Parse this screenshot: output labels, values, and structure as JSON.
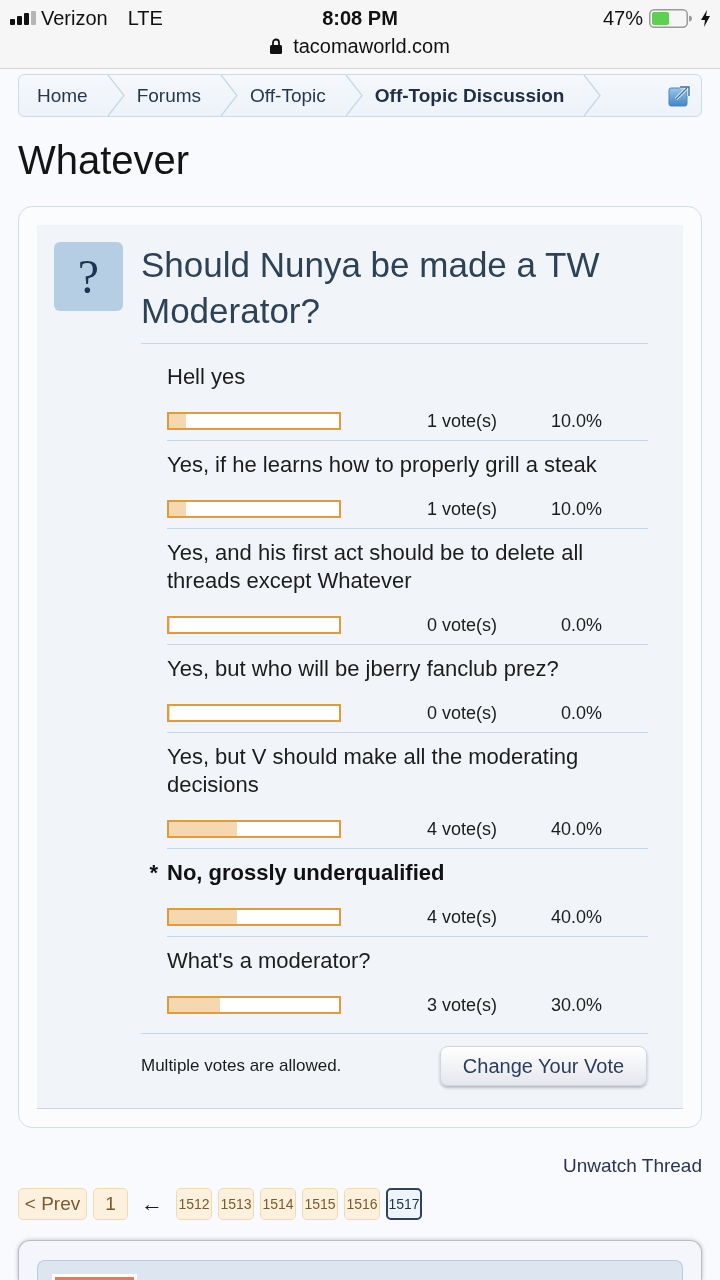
{
  "status_bar": {
    "carrier": "Verizon",
    "network": "LTE",
    "time": "8:08 PM",
    "battery": "47%",
    "charging": true
  },
  "address_bar": {
    "url": "tacomaworld.com",
    "secure": true
  },
  "breadcrumb": [
    {
      "label": "Home",
      "selected": false
    },
    {
      "label": "Forums",
      "selected": false
    },
    {
      "label": "Off-Topic",
      "selected": false
    },
    {
      "label": "Off-Topic Discussion",
      "selected": true
    }
  ],
  "thread_title": "Whatever",
  "poll": {
    "icon": "?",
    "question": "Should Nunya be made a TW Moderator?",
    "voted_marker": "*",
    "options": [
      {
        "label": "Hell yes",
        "voted": false,
        "level": 0.1,
        "votes": "1 vote(s)",
        "percent": "10.0%"
      },
      {
        "label": "Yes, if he learns how to properly grill a steak",
        "voted": false,
        "level": 0.1,
        "votes": "1 vote(s)",
        "percent": "10.0%"
      },
      {
        "label": "Yes, and his first act should be to delete all threads except Whatever",
        "voted": false,
        "level": 0,
        "votes": "0 vote(s)",
        "percent": "0.0%"
      },
      {
        "label": "Yes, but who will be jberry fanclub prez?",
        "voted": false,
        "level": 0,
        "votes": "0 vote(s)",
        "percent": "0.0%"
      },
      {
        "label": "Yes, but V should make all the moderating decisions",
        "voted": false,
        "level": 0.4,
        "votes": "4 vote(s)",
        "percent": "40.0%"
      },
      {
        "label": "No, grossly underqualified",
        "voted": true,
        "level": 0.4,
        "votes": "4 vote(s)",
        "percent": "40.0%"
      },
      {
        "label": "What's a moderator?",
        "voted": false,
        "level": 0.3,
        "votes": "3 vote(s)",
        "percent": "30.0%"
      }
    ],
    "note": "Multiple votes are allowed.",
    "button": "Change Your Vote"
  },
  "thread_actions": {
    "unwatch": "Unwatch Thread"
  },
  "pagination": {
    "prev": "< Prev",
    "first": {
      "label": "1",
      "selected": false
    },
    "jump": "←",
    "pages": [
      {
        "label": "1512",
        "selected": false
      },
      {
        "label": "1513",
        "selected": false
      },
      {
        "label": "1514",
        "selected": false
      },
      {
        "label": "1515",
        "selected": false
      },
      {
        "label": "1516",
        "selected": false
      },
      {
        "label": "1517",
        "selected": true
      }
    ]
  }
}
